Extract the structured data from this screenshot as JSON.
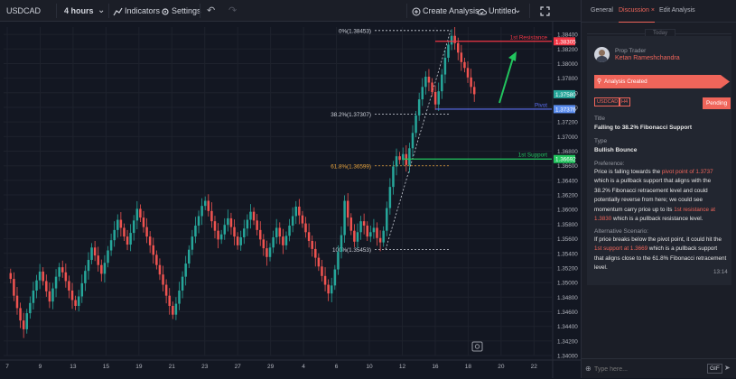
{
  "toolbar": {
    "symbol": "USDCAD",
    "interval": "4 hours",
    "indicators": "Indicators",
    "settings": "Settings",
    "create_analysis": "Create Analysis",
    "title": "Untitled"
  },
  "chart_data": {
    "type": "candlestick",
    "symbol": "USDCAD",
    "interval": "4 hours",
    "ylim": [
      1.34,
      1.385
    ],
    "y_ticks": [
      "1.38400",
      "1.38200",
      "1.38000",
      "1.37800",
      "1.37600",
      "1.37400",
      "1.37200",
      "1.37000",
      "1.36800",
      "1.36600",
      "1.36400",
      "1.36200",
      "1.36000",
      "1.35800",
      "1.35600",
      "1.35400",
      "1.35200",
      "1.35000",
      "1.34800",
      "1.34600",
      "1.34400",
      "1.34200",
      "1.34000"
    ],
    "x_ticks": [
      "7",
      "9",
      "13",
      "15",
      "19",
      "21",
      "23",
      "27",
      "29",
      "4",
      "6",
      "10",
      "12",
      "16",
      "18",
      "20",
      "22"
    ],
    "last_price_labels": [
      {
        "text": "1.37580",
        "color": "#26a69a"
      },
      {
        "text": "1.37376",
        "color": "#5b8def"
      }
    ],
    "levels": [
      {
        "name": "1st Resistance",
        "price": 1.38305,
        "color": "#f23645"
      },
      {
        "name": "Pivot",
        "price": 1.37376,
        "color": "#5b6ef0"
      },
      {
        "name": "1st Support",
        "price": 1.36692,
        "color": "#22c55e"
      }
    ],
    "fibonacci": [
      {
        "label": "0%(1.38453)",
        "price": 1.38453
      },
      {
        "label": "38.2%(1.37307)",
        "price": 1.37307
      },
      {
        "label": "61.8%(1.36599)",
        "price": 1.36599
      },
      {
        "label": "100%(1.35453)",
        "price": 1.35453
      }
    ],
    "candles_close": [
      1.3505,
      1.3482,
      1.3465,
      1.3448,
      1.3436,
      1.3458,
      1.3472,
      1.3489,
      1.3503,
      1.3515,
      1.3502,
      1.3488,
      1.3474,
      1.3492,
      1.3508,
      1.3521,
      1.3514,
      1.3502,
      1.3489,
      1.3476,
      1.3468,
      1.3481,
      1.3499,
      1.3516,
      1.3531,
      1.3548,
      1.3537,
      1.3524,
      1.3512,
      1.3527,
      1.3544,
      1.3558,
      1.3572,
      1.3586,
      1.3575,
      1.3563,
      1.3552,
      1.3568,
      1.3585,
      1.3601,
      1.3589,
      1.3576,
      1.3563,
      1.3551,
      1.3538,
      1.3524,
      1.3511,
      1.3497,
      1.3482,
      1.3468,
      1.3456,
      1.3471,
      1.3489,
      1.3508,
      1.3526,
      1.3545,
      1.3563,
      1.3578,
      1.3591,
      1.3605,
      1.3612,
      1.3598,
      1.3584,
      1.3571,
      1.3559,
      1.3566,
      1.3579,
      1.3588,
      1.3576,
      1.3563,
      1.3551,
      1.3562,
      1.3574,
      1.3586,
      1.3597,
      1.3585,
      1.3572,
      1.3559,
      1.3547,
      1.3535,
      1.3548,
      1.3562,
      1.3575,
      1.3563,
      1.3551,
      1.3564,
      1.3578,
      1.3591,
      1.3604,
      1.3592,
      1.3581,
      1.3569,
      1.3557,
      1.3546,
      1.3534,
      1.3522,
      1.3509,
      1.3497,
      1.3485,
      1.3496,
      1.3518,
      1.3542,
      1.3565,
      1.3612,
      1.3589,
      1.3571,
      1.3556,
      1.3569,
      1.3584,
      1.3578,
      1.3563,
      1.3569,
      1.3575,
      1.3561,
      1.3555,
      1.3571,
      1.3602,
      1.3631,
      1.3659,
      1.3673,
      1.3668,
      1.3676,
      1.3661,
      1.3684,
      1.3705,
      1.3729,
      1.3751,
      1.3768,
      1.3782,
      1.3774,
      1.3761,
      1.3744,
      1.3762,
      1.3785,
      1.3808,
      1.3826,
      1.3838,
      1.3828,
      1.3815,
      1.3802,
      1.3794,
      1.3781,
      1.3768,
      1.3758
    ]
  },
  "panel": {
    "tabs": [
      "General",
      "Discussion",
      "Edit Analysis"
    ],
    "date_chip": "Today",
    "author_role": "Prop Trader",
    "author_name": "Ketan Rameshchandra",
    "event": "Analysis Created",
    "tags": [
      "USDCAD",
      "H4"
    ],
    "status": "Pending",
    "title_label": "Title",
    "title_value": "Falling to 38.2% Fibonacci Support",
    "type_label": "Type",
    "type_value": "Bullish Bounce",
    "preference_label": "Preference:",
    "preference_parts": {
      "a": "Price is falling towards the ",
      "b": "pivot point of 1.3737",
      "c": " which is a pullback support that aligns with the 38.2% Fibonacci retracement level and could potentially reverse from here; we could see momentum carry price up to its ",
      "d": "1st resistance at 1.3830",
      "e": " which is a pullback resistance level."
    },
    "alt_label": "Alternative Scenario:",
    "alt_parts": {
      "a": "If price breaks below the pivot point, it could hit the ",
      "b": "1st support at 1.3669",
      "c": " which is a pullback support that aligns close to the 61.8% Fibonacci retracement level."
    },
    "time": "13:14",
    "input_placeholder": "Type here...",
    "gif_label": "GIF"
  },
  "colors": {
    "up": "#26a69a",
    "down": "#ef5350",
    "accent": "#f0655a"
  }
}
